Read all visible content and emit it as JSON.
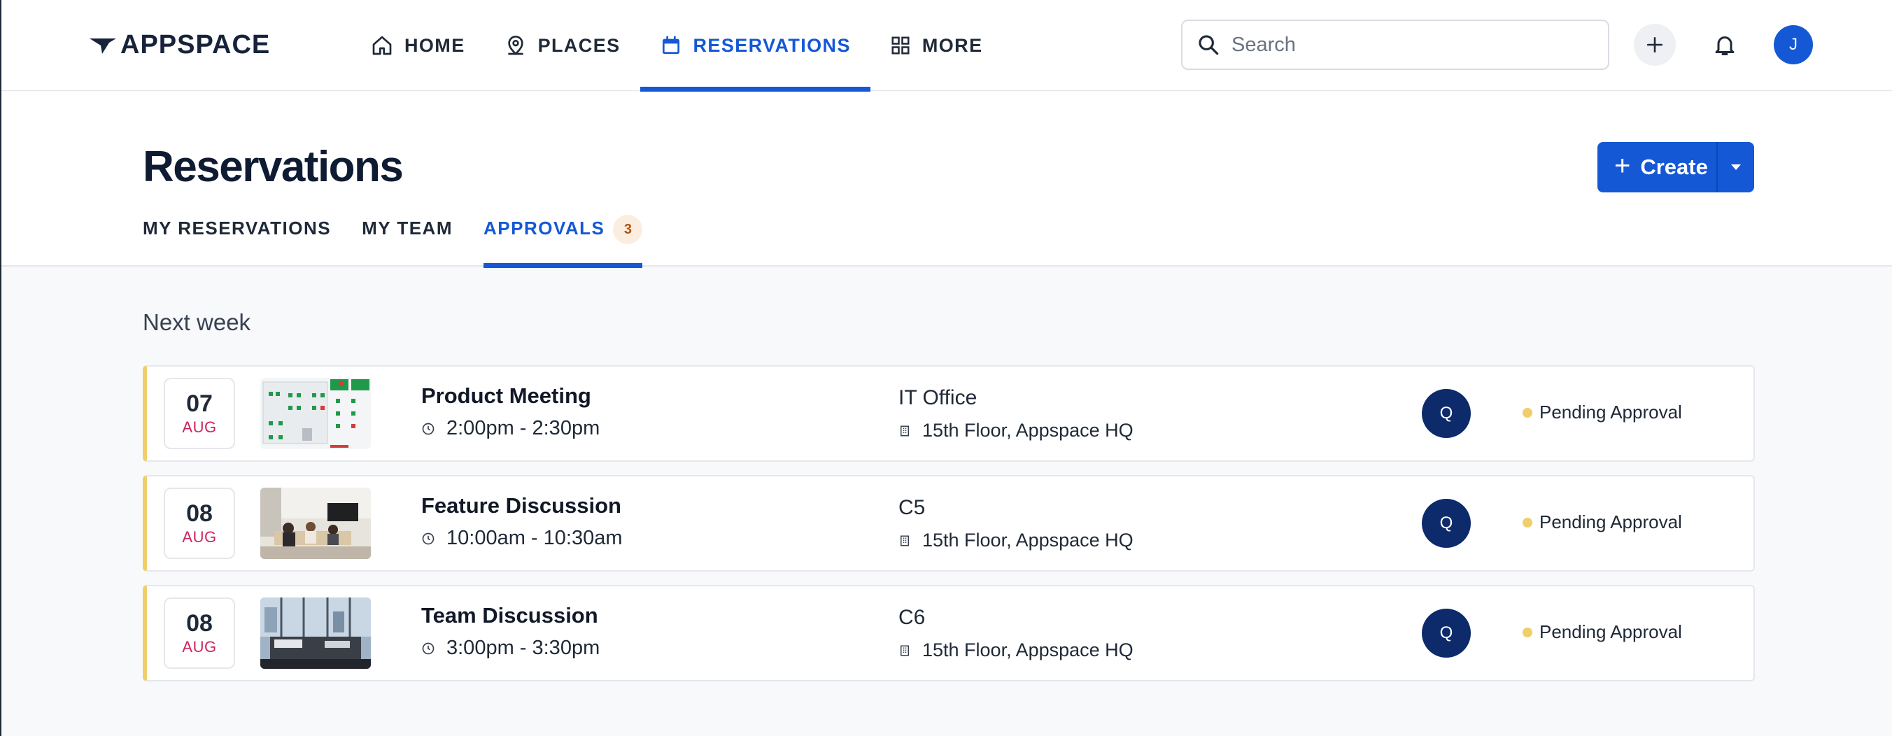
{
  "brand": {
    "logo_text": "APPSPACE"
  },
  "nav": {
    "items": [
      {
        "label": "HOME",
        "icon": "home-icon"
      },
      {
        "label": "PLACES",
        "icon": "places-icon"
      },
      {
        "label": "RESERVATIONS",
        "icon": "calendar-icon",
        "active": true
      },
      {
        "label": "MORE",
        "icon": "grid-icon"
      }
    ]
  },
  "search": {
    "placeholder": "Search"
  },
  "user": {
    "initial": "J"
  },
  "page": {
    "title": "Reservations",
    "create_label": "Create",
    "tabs": [
      {
        "label": "MY RESERVATIONS"
      },
      {
        "label": "MY TEAM"
      },
      {
        "label": "APPROVALS",
        "badge": "3",
        "active": true
      }
    ]
  },
  "section": {
    "label": "Next week"
  },
  "reservations": [
    {
      "day": "07",
      "month": "AUG",
      "title": "Product Meeting",
      "time": "2:00pm - 2:30pm",
      "place": "IT Office",
      "location": "15th Floor, Appspace HQ",
      "person_initial": "Q",
      "status": "Pending Approval",
      "thumb": "floorplan"
    },
    {
      "day": "08",
      "month": "AUG",
      "title": "Feature Discussion",
      "time": "10:00am - 10:30am",
      "place": "C5",
      "location": "15th Floor, Appspace HQ",
      "person_initial": "Q",
      "status": "Pending Approval",
      "thumb": "meeting-photo"
    },
    {
      "day": "08",
      "month": "AUG",
      "title": "Team Discussion",
      "time": "3:00pm - 3:30pm",
      "place": "C6",
      "location": "15th Floor, Appspace HQ",
      "person_initial": "Q",
      "status": "Pending Approval",
      "thumb": "office-photo"
    }
  ],
  "colors": {
    "accent": "#1458d6",
    "pending": "#f0cf6a",
    "avatar_dark": "#0d2a6b",
    "month": "#d0245a"
  }
}
